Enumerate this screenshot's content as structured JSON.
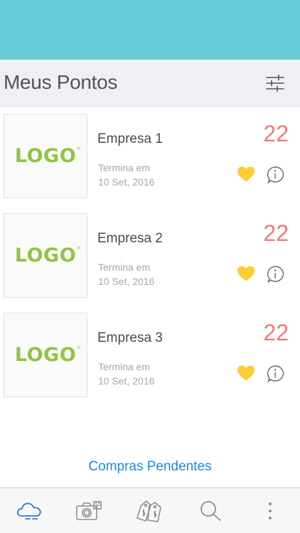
{
  "colors": {
    "top_bar": "#68ccd8",
    "header_bg": "#efeff4",
    "logo_green": "#8dc63f",
    "points": "#f17a7a",
    "heart": "#ffcc33",
    "link": "#1e88e5",
    "tab_active": "#2a7ad1",
    "tab_inactive": "#8e8e93"
  },
  "header": {
    "title": "Meus Pontos",
    "filter_icon": "sliders-icon"
  },
  "companies": [
    {
      "logo": "LOGO",
      "name": "Empresa 1",
      "ends_label": "Termina em",
      "ends_date": "10 Set, 2016",
      "points": "22"
    },
    {
      "logo": "LOGO",
      "name": "Empresa 2",
      "ends_label": "Termina em",
      "ends_date": "10 Set, 2016",
      "points": "22"
    },
    {
      "logo": "LOGO",
      "name": "Empresa 3",
      "ends_label": "Termina em",
      "ends_date": "10 Set, 2016",
      "points": "22"
    }
  ],
  "pending_link": "Compras Pendentes",
  "tabs": [
    {
      "icon": "cloud-icon",
      "active": true
    },
    {
      "icon": "camera-scan-icon",
      "active": false
    },
    {
      "icon": "price-tags-icon",
      "active": false
    },
    {
      "icon": "search-icon",
      "active": false
    },
    {
      "icon": "more-vertical-icon",
      "active": false
    }
  ]
}
